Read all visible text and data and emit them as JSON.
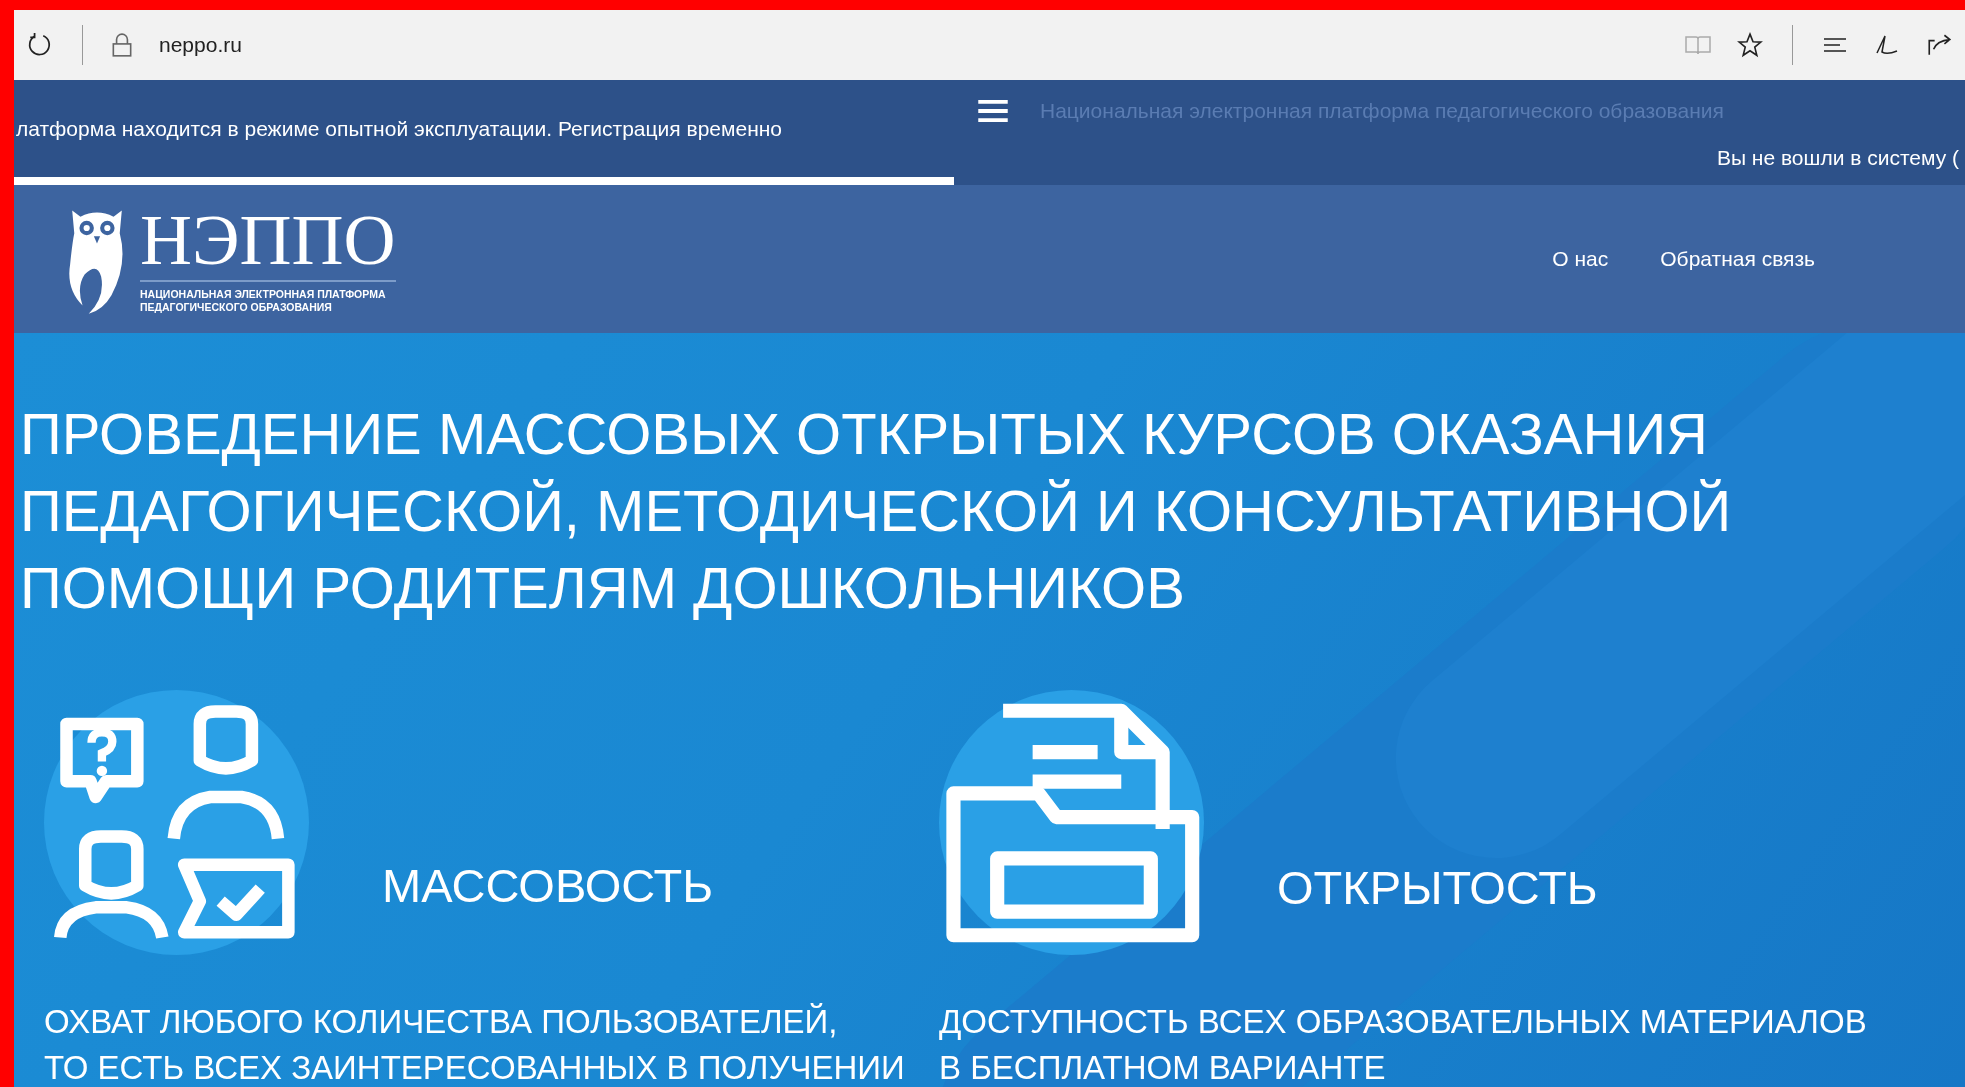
{
  "browser": {
    "url": "neppo.ru"
  },
  "notice": {
    "text": "латформа находится в режиме опытной эксплуатации. Регистрация временно"
  },
  "navbar": {
    "site_title": "Национальная электронная платформа педагогического образования",
    "login_status": "Вы не вошли в систему ("
  },
  "header": {
    "logo": {
      "title": "НЭППО",
      "subtitle_lines": [
        "НАЦИОНАЛЬНАЯ ЭЛЕКТРОННАЯ ПЛАТФОРМА",
        "ПЕДАГОГИЧЕСКОГО ОБРАЗОВАНИЯ"
      ]
    },
    "nav_links": [
      {
        "label": "О нас"
      },
      {
        "label": "Обратная связь"
      }
    ]
  },
  "hero": {
    "title_lines": [
      "ПРОВЕДЕНИЕ МАССОВЫХ ОТКРЫТЫХ КУРСОВ ОКАЗАНИЯ",
      "ПЕДАГОГИЧЕСКОЙ, МЕТОДИЧЕСКОЙ И КОНСУЛЬТАТИВНОЙ",
      "ПОМОЩИ РОДИТЕЛЯМ ДОШКОЛЬНИКОВ"
    ],
    "features": [
      {
        "kind": "people",
        "title": "МАССОВОСТЬ",
        "description_lines": [
          "ОХВАТ ЛЮБОГО КОЛИЧЕСТВА ПОЛЬЗОВАТЕЛЕЙ,",
          "ТО ЕСТЬ ВСЕХ ЗАИНТЕРЕСОВАННЫХ В ПОЛУЧЕНИИ"
        ]
      },
      {
        "kind": "folder",
        "title": "ОТКРЫТОСТЬ",
        "description_lines": [
          "ДОСТУПНОСТЬ ВСЕХ ОБРАЗОВАТЕЛЬНЫХ МАТЕРИАЛОВ",
          "В БЕСПЛАТНОМ ВАРИАНТЕ"
        ]
      }
    ]
  }
}
